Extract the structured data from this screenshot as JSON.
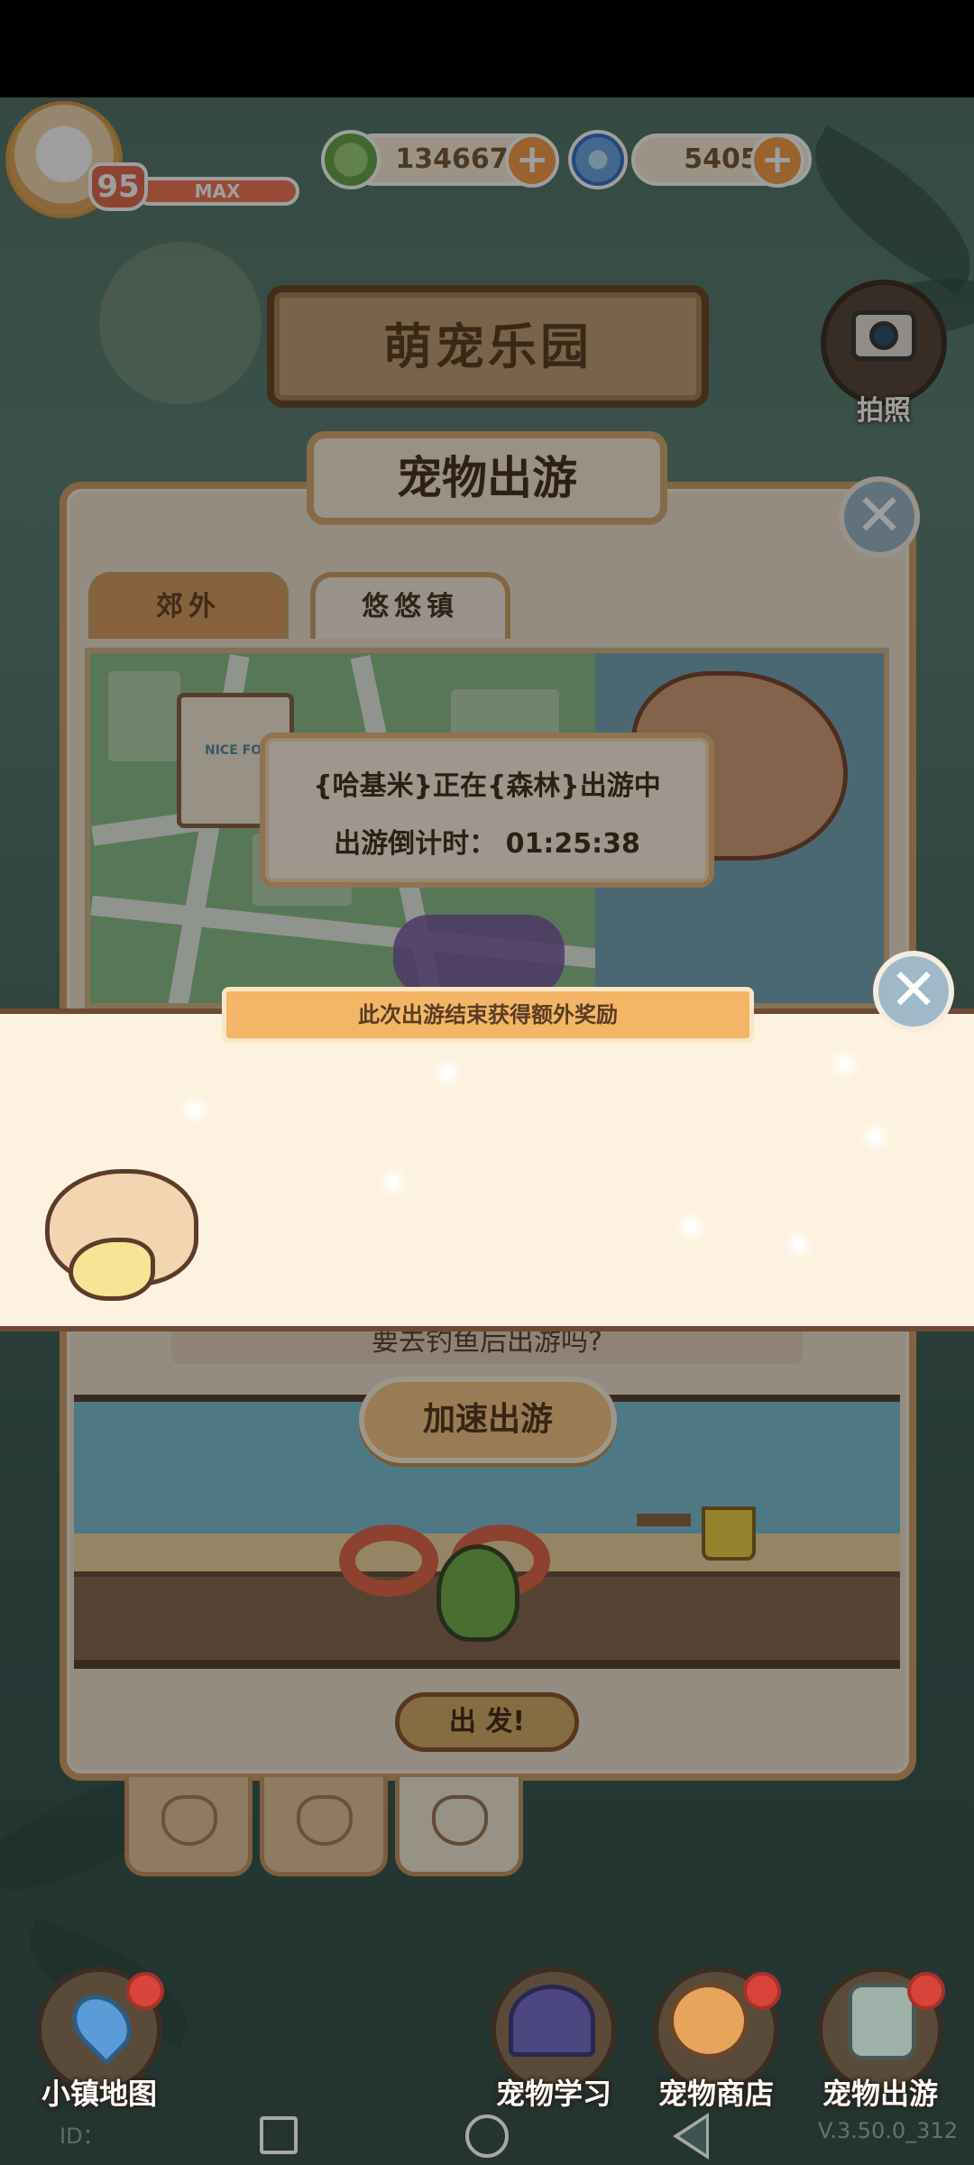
{
  "hud": {
    "level": "95",
    "level_status": "MAX",
    "leaf_currency": "134667",
    "swirl_currency": "5405",
    "plus_symbol": "+"
  },
  "header": {
    "title": "萌宠乐园",
    "camera_label": "拍照"
  },
  "panel": {
    "title": "宠物出游",
    "tabs": [
      {
        "label": "郊外",
        "active": true
      },
      {
        "label": "悠悠镇",
        "active": false
      }
    ],
    "map_sign_text": "NICE FOOD",
    "status_popup": {
      "line1": "{哈基米}正在{森林}出游中",
      "line2": "出游倒计时： 01:25:38"
    },
    "prompt_text": "要去钓鱼后出游吗?",
    "speed_button": "加速出游",
    "go_button": "出 发!"
  },
  "reward_popup": {
    "header": "此次出游结束获得额外奖励",
    "close_symbol": "✕"
  },
  "dock": {
    "items": [
      {
        "label": "小镇地图",
        "icon": "map-pin-icon",
        "badge": true
      },
      {
        "label": "宠物学习",
        "icon": "wizard-hat-icon",
        "badge": false
      },
      {
        "label": "宠物商店",
        "icon": "shiba-icon",
        "badge": true
      },
      {
        "label": "宠物出游",
        "icon": "travel-bag-icon",
        "badge": true
      }
    ]
  },
  "footer": {
    "id_text": "ID：",
    "version": "V.3.50.0_312"
  },
  "colors": {
    "badge_red": "#d8443a",
    "accent_orange": "#f5a04a",
    "panel_bg": "#efe3cf"
  }
}
